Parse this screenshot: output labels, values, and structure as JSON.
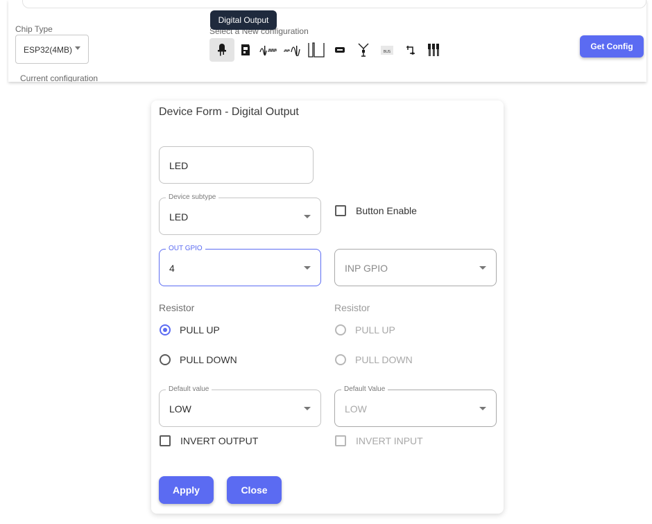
{
  "config_bar": {
    "chip_type_label": "Chip Type",
    "chip_type_value": "ESP32(4MB)",
    "new_config_label": "Select a New configuration",
    "current_config_label": "Current configuration",
    "get_config_label": "Get Config",
    "tooltip": "Digital Output",
    "device_icons": [
      {
        "name": "led-icon",
        "selected": true
      },
      {
        "name": "relay-icon",
        "selected": false
      },
      {
        "name": "pwm-icon",
        "selected": false
      },
      {
        "name": "analog-icon",
        "selected": false
      },
      {
        "name": "square-wave-icon",
        "selected": false
      },
      {
        "name": "display-icon",
        "selected": false
      },
      {
        "name": "antenna-icon",
        "selected": false
      },
      {
        "name": "bus-icon",
        "selected": false
      },
      {
        "name": "connector-icon",
        "selected": false
      },
      {
        "name": "multi-pin-icon",
        "selected": false
      }
    ],
    "bus_icon_text": "BUS"
  },
  "form": {
    "title": "Device Form - Digital Output",
    "device_name": "LED",
    "subtype_label": "Device subtype",
    "subtype_value": "LED",
    "button_enable_label": "Button Enable",
    "out_gpio_label": "OUT GPIO",
    "out_gpio_value": "4",
    "inp_gpio_placeholder": "INP GPIO",
    "out_resistor_label": "Resistor",
    "inp_resistor_label": "Resistor",
    "pull_up_label": "PULL UP",
    "pull_down_label": "PULL DOWN",
    "out_default_label": "Default value",
    "out_default_value": "LOW",
    "inp_default_label": "Default Value",
    "inp_default_value": "LOW",
    "invert_output_label": "INVERT OUTPUT",
    "invert_input_label": "INVERT INPUT",
    "apply_label": "Apply",
    "close_label": "Close"
  },
  "colors": {
    "accent": "#5b6bf2",
    "tooltip_bg": "#1f2a3d"
  }
}
